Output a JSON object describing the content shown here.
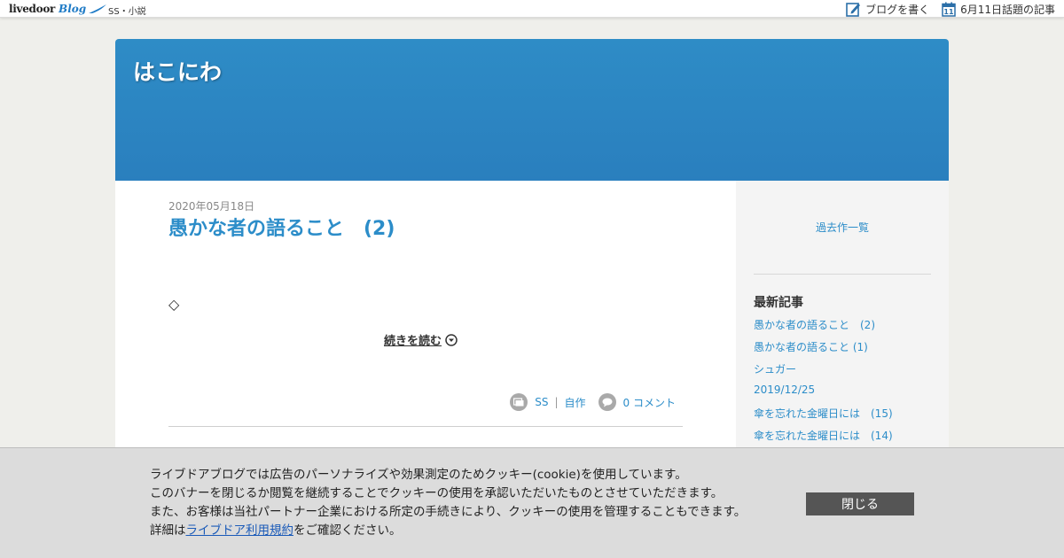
{
  "topbar": {
    "logo_text": "livedoor",
    "logo_blog": "Blog",
    "category": "SS・小説",
    "write_blog": "ブログを書く",
    "calendar_day": "11",
    "trending": "6月11日話題の記事"
  },
  "blog": {
    "title": "はこにわ"
  },
  "post": {
    "date": "2020年05月18日",
    "title": "愚かな者の語ること　(2)",
    "body": "◇",
    "read_more": "続きを読む",
    "categories": [
      "SS",
      "自作"
    ],
    "comments": "0 コメント"
  },
  "sidebar": {
    "archive_link": "過去作一覧",
    "recent_heading": "最新記事",
    "recent_items": [
      "愚かな者の語ること　(2)",
      "愚かな者の語ること (1)",
      "シュガー",
      "2019/12/25",
      "傘を忘れた金曜日には　(15)",
      "傘を忘れた金曜日には　(14)"
    ]
  },
  "cookie_banner": {
    "line1": "ライブドアブログでは広告のパーソナライズや効果測定のためクッキー(cookie)を使用しています。",
    "line2": "このバナーを閉じるか閲覧を継続することでクッキーの使用を承認いただいたものとさせていただきます。",
    "line3": "また、お客様は当社パートナー企業における所定の手続きにより、クッキーの使用を管理することもできます。",
    "line4_prefix": "詳細は",
    "line4_link": "ライブドア利用規約",
    "line4_suffix": "をご確認ください。",
    "close_label": "閉じる"
  },
  "colors": {
    "accent": "#2c8dc9",
    "header_bg": "#2a84c2",
    "page_bg": "#efefeb",
    "close_button": "#555555"
  },
  "icons": {
    "write": "pencil-note-icon",
    "calendar": "calendar-icon",
    "read_more": "circle-chevron-down-icon",
    "category": "folder-icon",
    "comment": "speech-bubble-icon"
  }
}
